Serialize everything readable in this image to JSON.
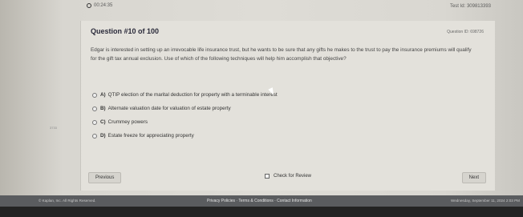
{
  "topbar": {
    "timer": "00:24:35",
    "test_id": "Test Id: 309813393"
  },
  "question": {
    "heading": "Question #10 of 100",
    "question_id": "Question ID: 698726",
    "text": "Edgar is interested in setting up an irrevocable life insurance trust, but he wants to be sure that any gifts he makes to the trust to pay the insurance premiums will qualify for the gift tax annual exclusion. Use of which of the following techniques will help him accomplish that objective?",
    "choices": [
      {
        "letter": "A)",
        "text": "QTIP election of the marital deduction for property with a terminable interest"
      },
      {
        "letter": "B)",
        "text": "Alternate valuation date for valuation of estate property"
      },
      {
        "letter": "C)",
        "text": "Crummey powers"
      },
      {
        "letter": "D)",
        "text": "Estate freeze for appreciating property"
      }
    ]
  },
  "nav": {
    "previous": "Previous",
    "review": "Check for Review",
    "next": "Next"
  },
  "footer": {
    "copyright": "© Kaplan, Inc. All Rights Reserved.",
    "links": "Privacy Policies · Terms & Conditions · Contact Information",
    "date": "Wednesday, September 11, 2024 2:03 PM"
  },
  "side_mark": "3733"
}
